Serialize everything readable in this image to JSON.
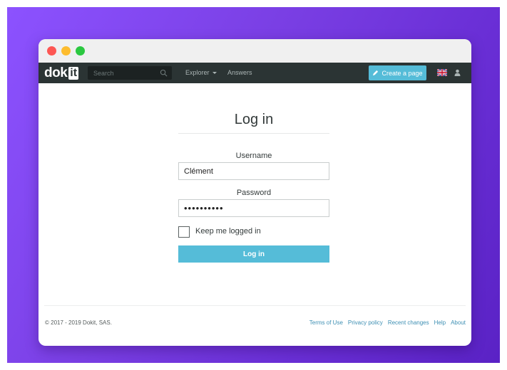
{
  "colors": {
    "background_gradient_start": "#8c52ff",
    "background_gradient_end": "#5a22c5",
    "navbar": "#2b3434",
    "accent": "#55bcd8",
    "link": "#3d8fb3"
  },
  "window": {
    "controls": [
      "close",
      "minimize",
      "maximize"
    ]
  },
  "navbar": {
    "logo_text": "dok",
    "logo_badge": "it",
    "search_placeholder": "Search",
    "explorer_label": "Explorer",
    "answers_label": "Answers",
    "create_page_label": "Create a page",
    "language_icon": "uk-flag-icon",
    "user_icon": "user-icon"
  },
  "login": {
    "title": "Log in",
    "username_label": "Username",
    "username_value": "Clément",
    "password_label": "Password",
    "password_value": "••••••••••",
    "keep_logged_in_label": "Keep me logged in",
    "keep_logged_in_checked": false,
    "submit_label": "Log in"
  },
  "footer": {
    "copyright": "© 2017 - 2019 Dokit, SAS.",
    "links": [
      "Terms of Use",
      "Privacy policy",
      "Recent changes",
      "Help",
      "About"
    ]
  }
}
